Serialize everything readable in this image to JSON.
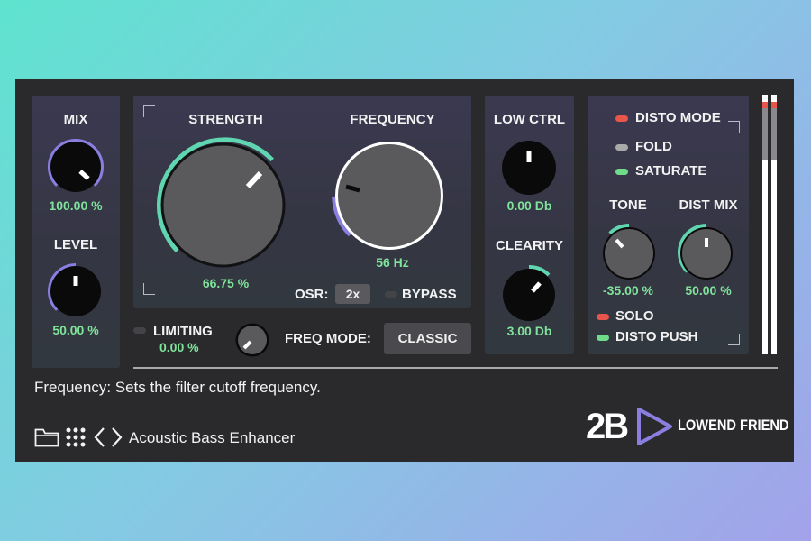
{
  "colors": {
    "accent_teal": "#5fd6b0",
    "accent_purple": "#8a7fe0",
    "value_green": "#7fe39b",
    "led_red": "#e8554b",
    "led_grey": "#aaaaaa",
    "led_green": "#6fdc8a",
    "led_off": "#444448"
  },
  "mix": {
    "label": "MIX",
    "value": "100.00 %",
    "level": 1.0
  },
  "level": {
    "label": "LEVEL",
    "value": "50.00 %",
    "level": 0.5
  },
  "strength": {
    "label": "STRENGTH",
    "value": "66.75 %",
    "level": 0.6675
  },
  "frequency": {
    "label": "FREQUENCY",
    "value": "56 Hz"
  },
  "osr": {
    "label": "OSR:",
    "value": "2x"
  },
  "bypass": {
    "label": "BYPASS",
    "state": "off"
  },
  "limiting": {
    "label": "LIMITING",
    "value": "0.00 %",
    "state": "off"
  },
  "freq_mode": {
    "label": "FREQ MODE:",
    "value": "CLASSIC"
  },
  "low_ctrl": {
    "label": "LOW CTRL",
    "value": "0.00 Db"
  },
  "clearity": {
    "label": "CLEARITY",
    "value": "3.00 Db"
  },
  "disto": {
    "mode_label": "DISTO MODE",
    "options": [
      "FOLD",
      "SATURATE"
    ],
    "selected": "SATURATE",
    "tone": {
      "label": "TONE",
      "value": "-35.00 %"
    },
    "dist_mix": {
      "label": "DIST MIX",
      "value": "50.00 %"
    },
    "solo": {
      "label": "SOLO",
      "state": "on"
    },
    "disto_push": {
      "label": "DISTO PUSH",
      "state": "on"
    }
  },
  "status_text": "Frequency: Sets the filter cutoff frequency.",
  "preset_name": "Acoustic Bass Enhancer",
  "brand": {
    "logo": "2B",
    "product": "LOWEND FRIEND"
  },
  "icons": [
    "folder-icon",
    "grid-icon",
    "chevron-left-icon",
    "chevron-right-icon",
    "play-triangle-logo-icon"
  ]
}
